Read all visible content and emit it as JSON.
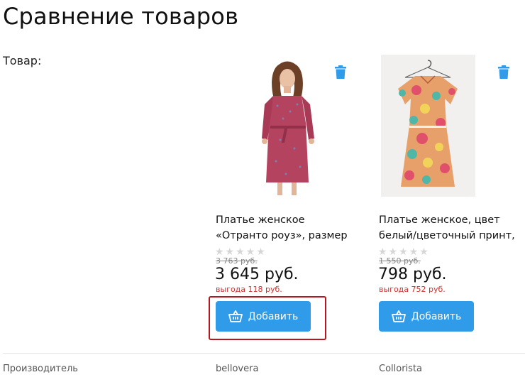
{
  "page": {
    "title": "Сравнение товаров"
  },
  "rows": {
    "product_label": "Товар:",
    "manufacturer_label": "Производитель"
  },
  "products": [
    {
      "name_line1": "Платье женское",
      "name_line2": "«Отранто роуз», размер",
      "rating": 0,
      "rating_stars": "★★★★★",
      "old_price": "3 763 руб.",
      "price": "3 645 руб.",
      "saving": "выгода 118 руб.",
      "add_label": "Добавить",
      "manufacturer": "bellovera"
    },
    {
      "name_line1": "Платье женское, цвет",
      "name_line2": "белый/цветочный принт,",
      "rating": 0,
      "rating_stars": "★★★★★",
      "old_price": "1 550 руб.",
      "price": "798 руб.",
      "saving": "выгода 752 руб.",
      "add_label": "Добавить",
      "manufacturer": "Collorista"
    }
  ],
  "icons": {
    "delete": "trash-icon",
    "cart": "basket-icon"
  },
  "colors": {
    "accent": "#2f9be9",
    "saving": "#d32f2f",
    "highlight": "#b5161f"
  }
}
